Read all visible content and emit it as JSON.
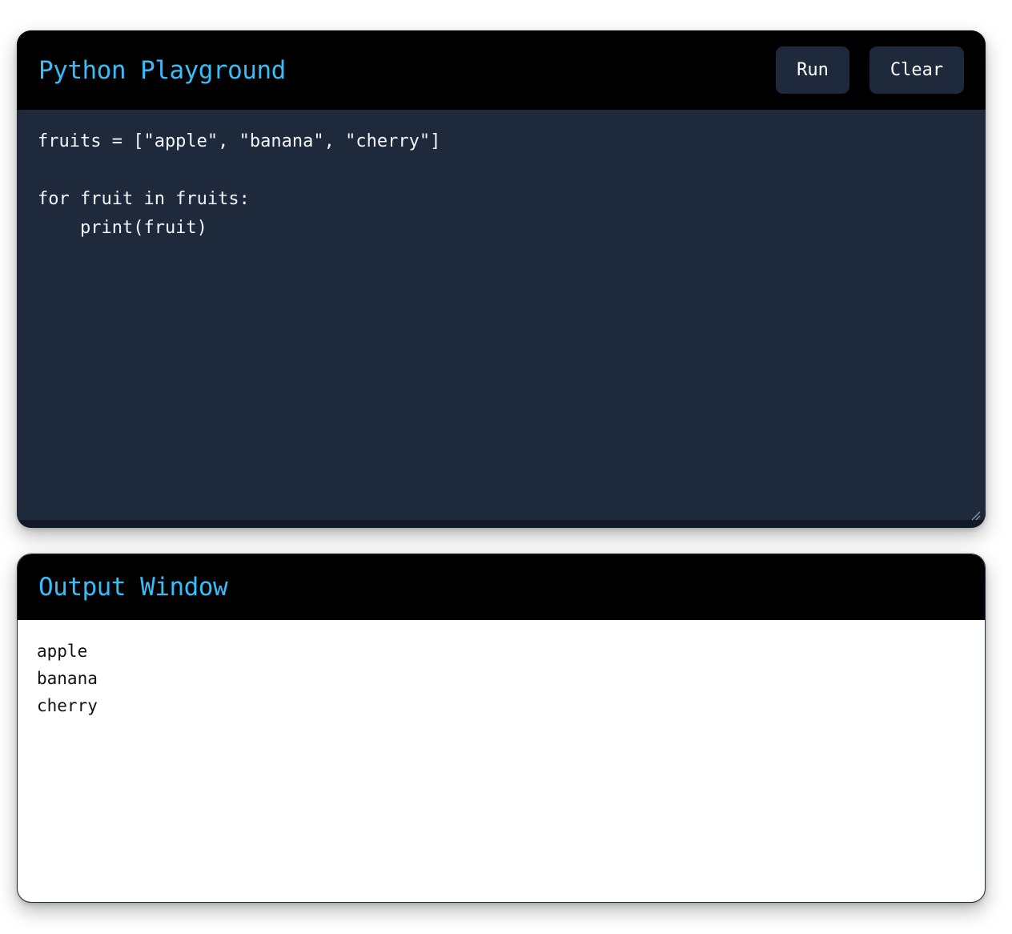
{
  "editor": {
    "title": "Python Playground",
    "run_label": "Run",
    "clear_label": "Clear",
    "code": "fruits = [\"apple\", \"banana\", \"cherry\"]\n\nfor fruit in fruits:\n    print(fruit)"
  },
  "output": {
    "title": "Output Window",
    "lines": [
      "apple",
      "banana",
      "cherry"
    ]
  },
  "colors": {
    "accent": "#38bdf8",
    "editor_bg": "#1e293b",
    "header_bg": "#000000",
    "button_bg": "#1e293b"
  },
  "icons": {
    "resize": "resize-handle-icon"
  }
}
